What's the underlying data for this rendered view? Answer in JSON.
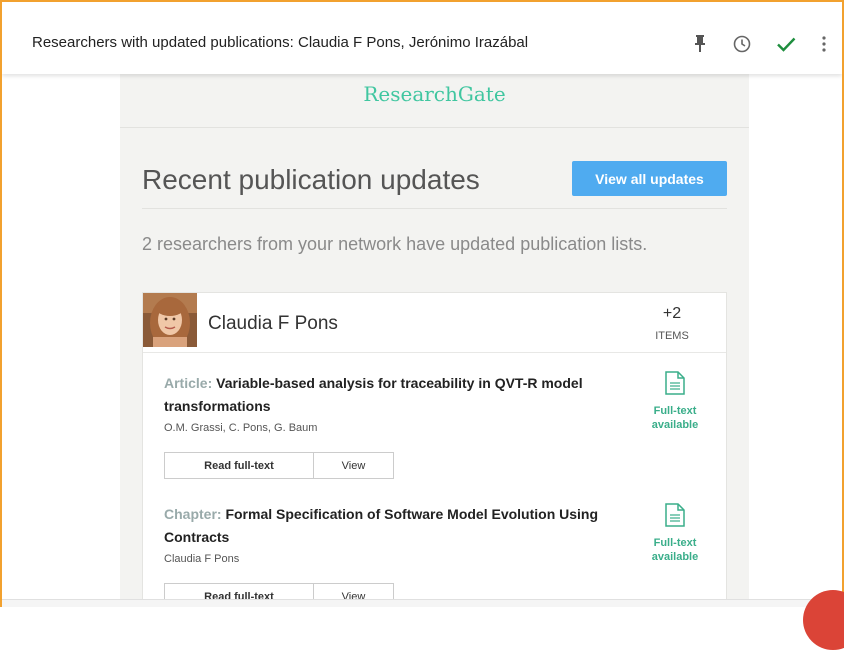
{
  "header": {
    "subject": "Researchers with updated publications: Claudia F Pons, Jerónimo Irazábal",
    "icons": [
      "pin-icon",
      "clock-icon",
      "check-icon",
      "more-vert-icon"
    ]
  },
  "email": {
    "brand": "ResearchGate",
    "headline": "Recent publication updates",
    "view_all_label": "View all updates",
    "subline": "2 researchers from your network have updated publication lists.",
    "researcher": {
      "name": "Claudia F Pons",
      "count": "+2",
      "count_label": "ITEMS"
    },
    "publications": [
      {
        "type": "Article:",
        "title": "Variable-based analysis for traceability in QVT-R model transformations",
        "authors": "O.M. Grassi, C. Pons, G. Baum",
        "read_label": "Read full-text",
        "view_label": "View",
        "fulltext_line1": "Full-text",
        "fulltext_line2": "available"
      },
      {
        "type": "Chapter:",
        "title": "Formal Specification of Software Model Evolution Using Contracts",
        "authors": "Claudia F Pons",
        "read_label": "Read full-text",
        "view_label": "View",
        "fulltext_line1": "Full-text",
        "fulltext_line2": "available"
      }
    ]
  },
  "colors": {
    "brand": "#40c6a0",
    "button": "#4fabf0",
    "check": "#1e8e3e",
    "frame": "#f2a12f"
  }
}
